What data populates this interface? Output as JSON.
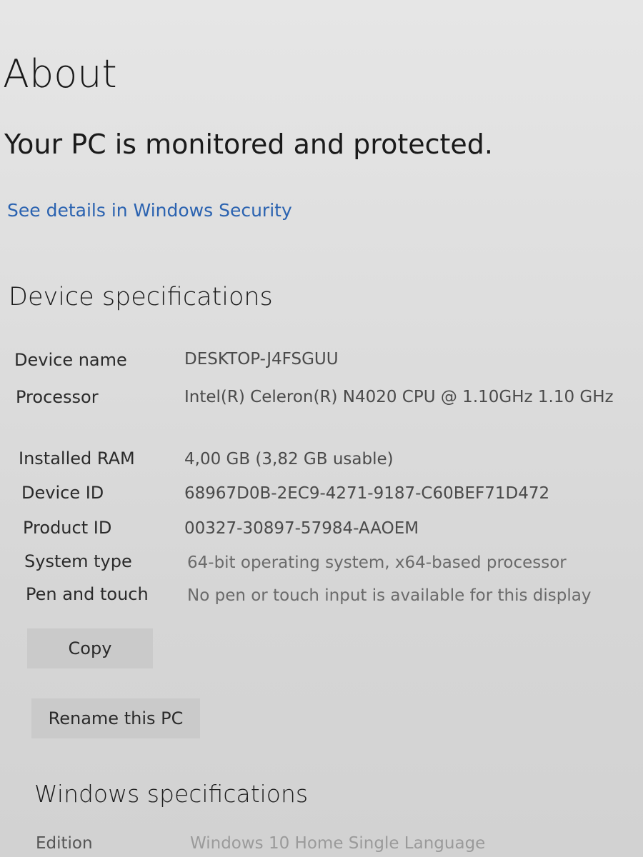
{
  "header": {
    "title": "About",
    "protection_status": "Your PC is monitored and protected.",
    "security_link": "See details in Windows Security"
  },
  "device_specs": {
    "heading": "Device specifications",
    "rows": [
      {
        "label": "Device name",
        "value": "DESKTOP-J4FSGUU"
      },
      {
        "label": "Processor",
        "value": "Intel(R) Celeron(R) N4020 CPU @ 1.10GHz   1.10 GHz"
      },
      {
        "label": "Installed RAM",
        "value": "4,00 GB (3,82 GB usable)"
      },
      {
        "label": "Device ID",
        "value": "68967D0B-2EC9-4271-9187-C60BEF71D472"
      },
      {
        "label": "Product ID",
        "value": "00327-30897-57984-AAOEM"
      },
      {
        "label": "System type",
        "value": "64-bit operating system, x64-based processor"
      },
      {
        "label": "Pen and touch",
        "value": "No pen or touch input is available for this display"
      }
    ],
    "copy_label": "Copy",
    "rename_label": "Rename this PC"
  },
  "windows_specs": {
    "heading": "Windows specifications",
    "rows": [
      {
        "label": "Edition",
        "value": "Windows 10 Home Single Language"
      }
    ]
  },
  "colors": {
    "link": "#2a62b0",
    "button_bg": "#cacaca",
    "background": "#dcdcdc"
  }
}
